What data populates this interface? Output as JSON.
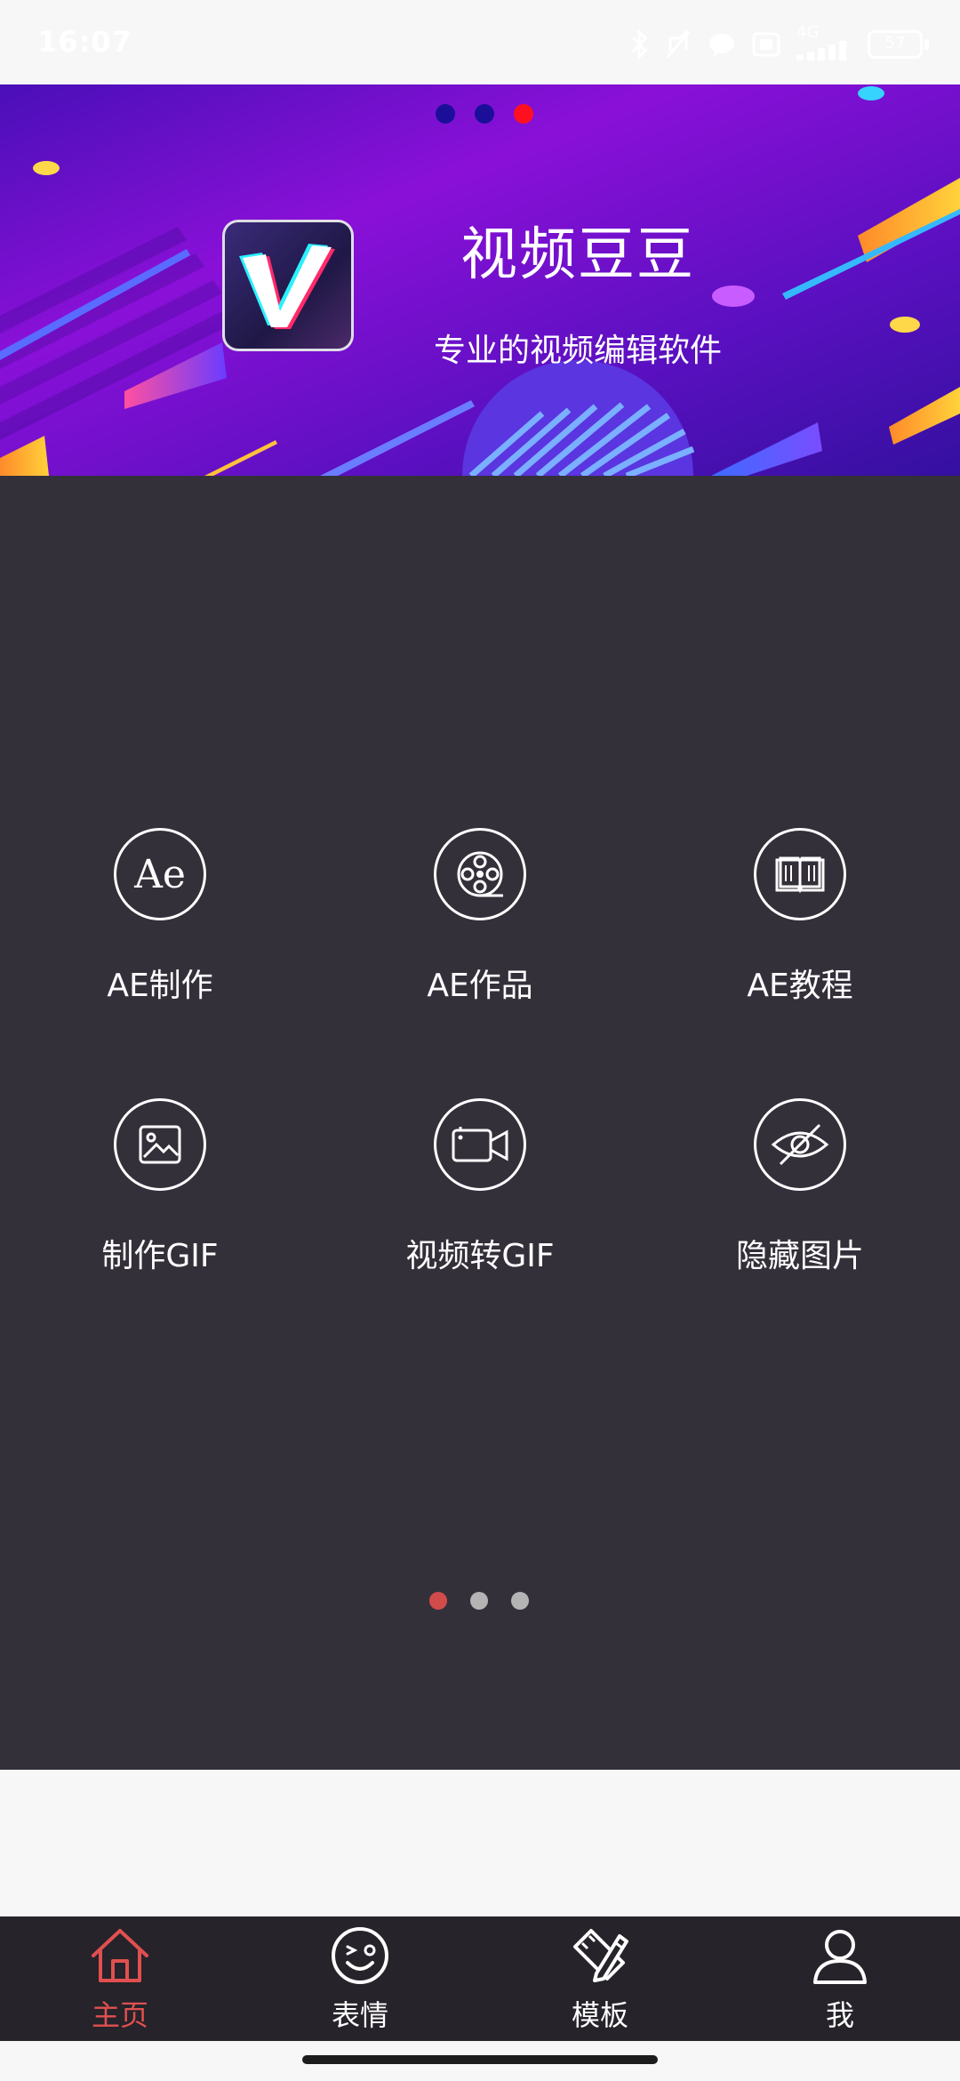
{
  "status_bar": {
    "time": "16:07",
    "network": "4G",
    "battery": "57"
  },
  "banner": {
    "title": "视频豆豆",
    "subtitle": "专业的视频编辑软件",
    "dots": [
      {
        "active": false
      },
      {
        "active": false
      },
      {
        "active": true
      }
    ],
    "colors": {
      "accent": "#ff1020",
      "bg_start": "#5a0fc8",
      "bg_end": "#3b10a8"
    }
  },
  "grid": {
    "items": [
      {
        "label": "AE制作",
        "icon": "ae-icon"
      },
      {
        "label": "AE作品",
        "icon": "film-reel-icon"
      },
      {
        "label": "AE教程",
        "icon": "book-icon"
      },
      {
        "label": "制作GIF",
        "icon": "image-icon"
      },
      {
        "label": "视频转GIF",
        "icon": "video-camera-icon"
      },
      {
        "label": "隐藏图片",
        "icon": "eye-off-icon"
      }
    ],
    "ae_glyph": "Ae",
    "page_dots": [
      {
        "active": true
      },
      {
        "active": false
      },
      {
        "active": false
      }
    ]
  },
  "bottom_nav": {
    "items": [
      {
        "label": "主页",
        "icon": "home-icon",
        "active": true
      },
      {
        "label": "表情",
        "icon": "emoji-icon",
        "active": false
      },
      {
        "label": "模板",
        "icon": "template-icon",
        "active": false
      },
      {
        "label": "我",
        "icon": "user-icon",
        "active": false
      }
    ],
    "active_color": "#e05050"
  }
}
